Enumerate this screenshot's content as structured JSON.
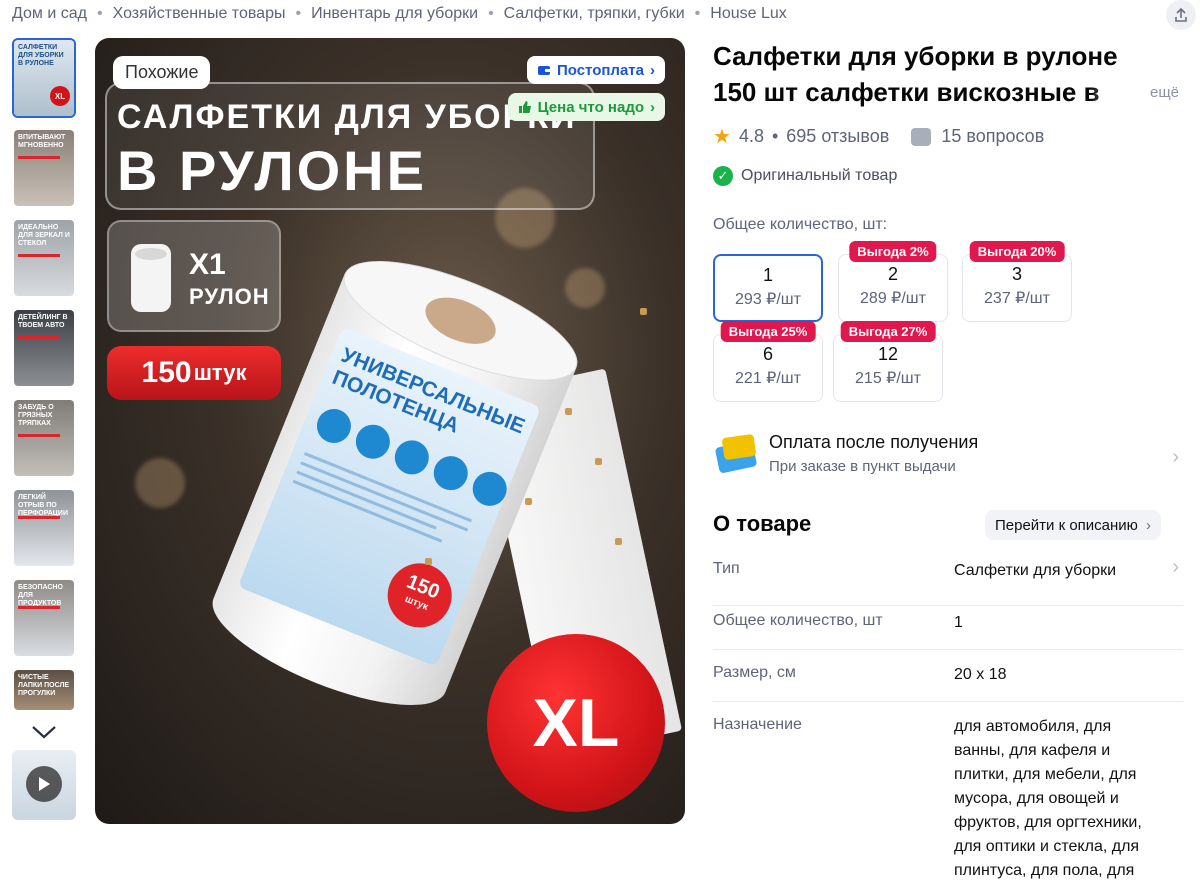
{
  "breadcrumbs": [
    "Дом и сад",
    "Хозяйственные товары",
    "Инвентарь для уборки",
    "Салфетки, тряпки, губки",
    "House Lux"
  ],
  "gallery": {
    "thumbs": [
      {
        "caption": "Салфетки для уборки в рулоне",
        "bg": "#dfe8ef"
      },
      {
        "caption": "Впитывают мгновенно",
        "bg": "#8a8079"
      },
      {
        "caption": "Идеально для зеркал и стекол",
        "bg": "#b6b9bd"
      },
      {
        "caption": "Детейлинг в твоем авто",
        "bg": "#4b4d52"
      },
      {
        "caption": "Забудь о грязных тряпках",
        "bg": "#a4a19d"
      },
      {
        "caption": "Легкий отрыв по перфорации",
        "bg": "#c9cfd6"
      },
      {
        "caption": "Безопасно для продуктов",
        "bg": "#d6dbe0"
      },
      {
        "caption": "Чистые лапки после прогулки",
        "bg": "#8d7966"
      }
    ]
  },
  "main_image": {
    "similar_label": "Похожие",
    "postpay_label": "Постоплата",
    "fair_price_label": "Цена что надо",
    "headline_line1": "САЛФЕТКИ ДЛЯ УБОРКИ",
    "headline_line2": "В РУЛОНЕ",
    "roll_count": "X1",
    "roll_word": "РУЛОН",
    "pieces_number": "150",
    "pieces_word": "штук",
    "size_badge": "XL",
    "package_title_1": "УНИВЕРСАЛЬНЫЕ",
    "package_title_2": "ПОЛОТЕНЦА",
    "package_badge_number": "150",
    "package_badge_word": "штук"
  },
  "product": {
    "title": "Салфетки для уборки в рулоне 150 шт салфетки вискозные в",
    "more_label": "ещё",
    "rating": "4.8",
    "reviews": "695 отзывов",
    "questions": "15 вопросов",
    "original_label": "Оригинальный товар",
    "qty_label": "Общее количество, шт:"
  },
  "options": [
    {
      "qty": "1",
      "price": "293 ₽/шт",
      "badge": "",
      "selected": true
    },
    {
      "qty": "2",
      "price": "289 ₽/шт",
      "badge": "Выгода 2%",
      "selected": false
    },
    {
      "qty": "3",
      "price": "237 ₽/шт",
      "badge": "Выгода 20%",
      "selected": false
    },
    {
      "qty": "6",
      "price": "221 ₽/шт",
      "badge": "Выгода 25%",
      "selected": false
    },
    {
      "qty": "12",
      "price": "215 ₽/шт",
      "badge": "Выгода 27%",
      "selected": false
    }
  ],
  "payment": {
    "title": "Оплата после получения",
    "subtitle": "При заказе в пункт выдачи"
  },
  "about": {
    "heading": "О товаре",
    "goto_label": "Перейти к описанию",
    "specs": [
      {
        "key": "Тип",
        "value": "Салфетки для уборки"
      },
      {
        "key": "Общее количество, шт",
        "value": "1"
      },
      {
        "key": "Размер, см",
        "value": "20 x 18"
      },
      {
        "key": "Назначение",
        "value": "для автомобиля, для ванны, для кафеля и плитки, для мебели, для мусора, для овощей и фруктов, для оргтехники, для оптики и стекла, для плинтуса, для пола, для посуды, для"
      }
    ]
  },
  "colors": {
    "accent": "#2b63d9",
    "badge": "#e0184e",
    "rating_star": "#f6a20d",
    "check": "#19b34a"
  }
}
